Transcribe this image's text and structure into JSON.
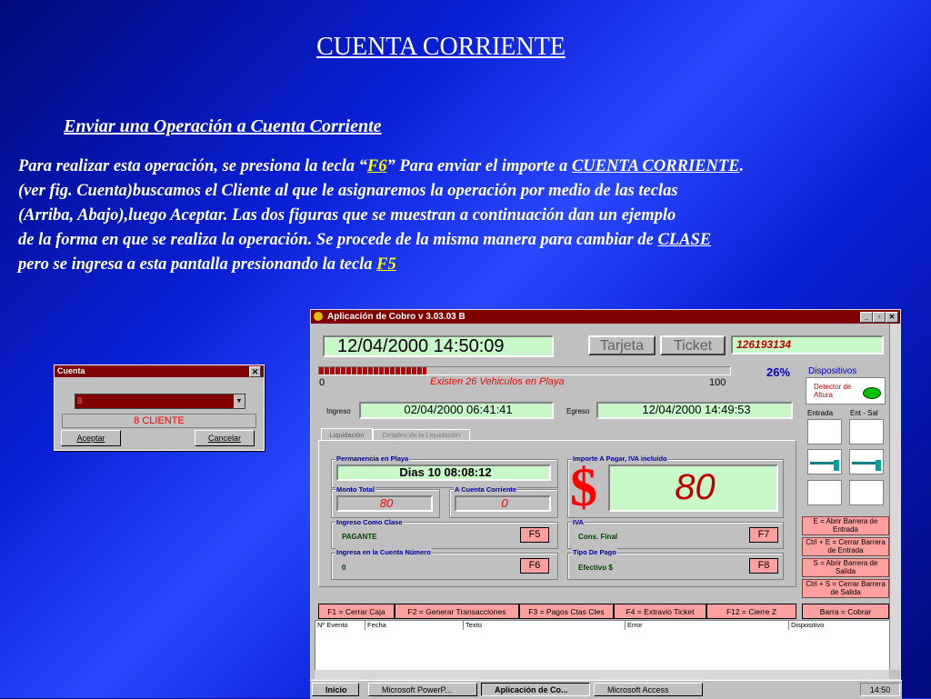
{
  "slide": {
    "title": "CUENTA CORRIENTE",
    "subtitle": "Enviar una Operación a Cuenta Corriente",
    "p1a": "Para realizar esta operación, se presiona la tecla “",
    "p1key": "F6",
    "p1b": "” Para enviar el importe a ",
    "p1link": "CUENTA CORRIENTE",
    "p1c": ".",
    "p2": "(ver fig. Cuenta)buscamos el Cliente al que le asignaremos la operación por medio de las teclas",
    "p3": "(Arriba, Abajo),luego Aceptar. Las dos figuras que se muestran a continuación dan un ejemplo",
    "p4a": "de la forma en que se realiza la operación. Se procede de la misma manera para cambiar de ",
    "p4link": "CLASE",
    "p5a": "pero se ingresa a esta pantalla presionando la tecla ",
    "p5key": "F5"
  },
  "cuenta_dialog": {
    "title": "Cuenta",
    "combo_value": "8",
    "selected": "8 CLIENTE",
    "ok": "Aceptar",
    "cancel": "Cancelar"
  },
  "app": {
    "title": "Aplicación de Cobro v 3.03.03 B",
    "datetime": "12/04/2000  14:50:09",
    "tarjeta": "Tarjeta",
    "ticket": "Ticket",
    "ticket_number": "126193134",
    "progress_pct": "26%",
    "progress_fraction": 0.26,
    "progress_min": "0",
    "progress_max": "100",
    "vehicles_msg": "Existen 26 Vehiculos en Playa",
    "ingreso_label": "Ingreso",
    "ingreso_value": "02/04/2000 06:41:41",
    "egreso_label": "Egreso",
    "egreso_value": "12/04/2000 14:49:53",
    "tab_liquidacion": "Liquidación",
    "tab_detalles": "Detalles de la Liquidación",
    "permanencia_label": "Permanencia en Playa",
    "permanencia_value": "Dias 10  08:08:12",
    "monto_label": "Monto Total",
    "monto_value": "80",
    "acuenta_label": "A Cuenta Corriente",
    "acuenta_value": "0",
    "importe_label": "Importe A Pagar, IVA incluido",
    "currency": "$",
    "importe_value": "80",
    "clase_label": "Ingreso Como Clase",
    "clase_value": "PAGANTE",
    "clase_key": "F5",
    "iva_label": "IVA",
    "iva_value": "Cons. Final",
    "iva_key": "F7",
    "cuenta_label": "Ingresa en la Cuenta Número",
    "cuenta_value": "0",
    "cuenta_key": "F6",
    "pago_label": "Tipo De Pago",
    "pago_value": "Efectivo $",
    "pago_key": "F8",
    "dispositivos": "Dispositivos",
    "detector": "Detector de Altura",
    "entrada": "Entrada",
    "ent_sal": "Ent - Sal",
    "btn_e": "E = Abrir Barrera de Entrada",
    "btn_ctrl_e": "Ctrl + E = Cerrar Barrera de Entrada",
    "btn_s": "S = Abrir Barrera  de Salida",
    "btn_ctrl_s": "Ctrl  + S = Cerrar Barrera de Salida",
    "f1": "F1 = Cerrar Caja",
    "f2": "F2 = Generar Transacciones",
    "f3": "F3 = Pagos Ctas Ctes",
    "f4": "F4 = Extravio Ticket",
    "f12": "F12 = Cierre Z",
    "barra": "Barra = Cobrar",
    "col_evento": "Nº Evento",
    "col_fecha": "Fecha",
    "col_texto": "Texto",
    "col_error": "Error",
    "col_dispositivo": "Dispositivo"
  },
  "taskbar": {
    "start": "Inicio",
    "t1": "Microsoft PowerP...",
    "t2": "Aplicación de Co...",
    "t3": "Microsoft Access",
    "clock": "14:50"
  }
}
